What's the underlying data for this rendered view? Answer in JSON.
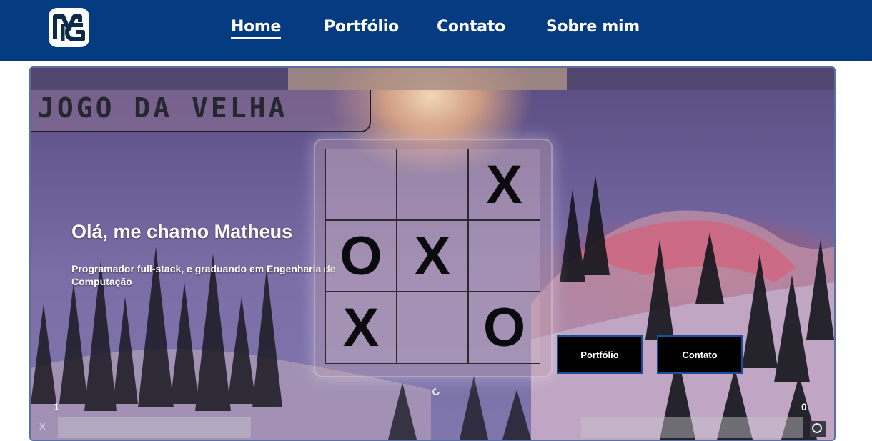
{
  "header": {
    "logo_text": "MG",
    "nav": [
      {
        "label": "Home",
        "active": true
      },
      {
        "label": "Portfólio",
        "active": false
      },
      {
        "label": "Contato",
        "active": false
      },
      {
        "label": "Sobre mim",
        "active": false
      }
    ]
  },
  "hero": {
    "game_title": "JOGO DA VELHA",
    "greeting": "Olá, me chamo Matheus",
    "subtitle": "Programador full-stack, e graduando em Engenharia de Computação",
    "buttons": {
      "portfolio": "Portfólio",
      "contato": "Contato"
    },
    "board": [
      "",
      "",
      "X",
      "O",
      "X",
      "",
      "X",
      "",
      "O"
    ],
    "score": {
      "left": "1",
      "right": "0",
      "left_symbol": "X",
      "right_icon": "search-icon"
    }
  },
  "colors": {
    "navbar": "#053b80",
    "button_bg": "#000000",
    "button_border": "#1b4d9a",
    "text": "#ffffff"
  }
}
